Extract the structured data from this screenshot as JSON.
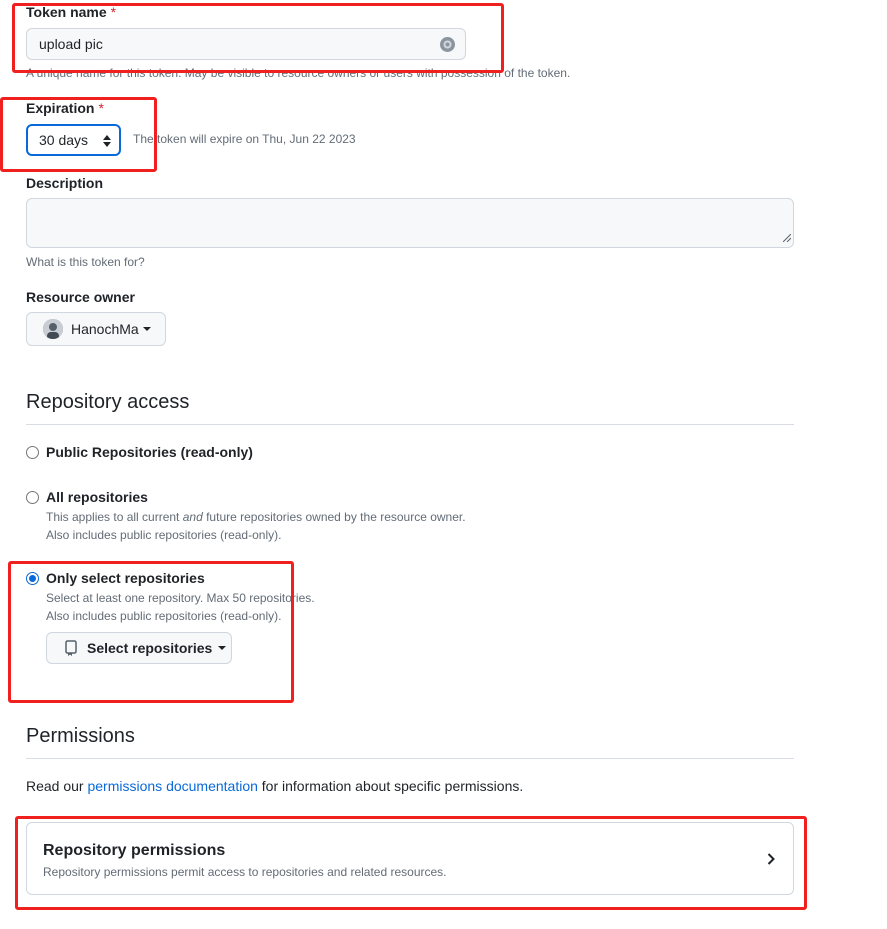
{
  "token_name": {
    "label": "Token name",
    "required_mark": "*",
    "value": "upload pic",
    "hint": "A unique name for this token. May be visible to resource owners or users with possession of the token."
  },
  "expiration": {
    "label": "Expiration",
    "required_mark": "*",
    "selected": "30 days",
    "note": "The token will expire on Thu, Jun 22 2023"
  },
  "description": {
    "label": "Description",
    "value": "",
    "hint": "What is this token for?"
  },
  "resource_owner": {
    "label": "Resource owner",
    "owner": "HanochMa"
  },
  "repository_access": {
    "heading": "Repository access",
    "options": [
      {
        "title": "Public Repositories (read-only)",
        "desc1": "",
        "desc2": "",
        "selected": false
      },
      {
        "title": "All repositories",
        "desc1_pre": "This applies to all current ",
        "desc1_em": "and",
        "desc1_post": " future repositories owned by the resource owner.",
        "desc2": "Also includes public repositories (read-only).",
        "selected": false
      },
      {
        "title": "Only select repositories",
        "desc1": "Select at least one repository. Max 50 repositories.",
        "desc2": "Also includes public repositories (read-only).",
        "selected": true
      }
    ],
    "select_button": "Select repositories"
  },
  "permissions": {
    "heading": "Permissions",
    "text_pre": "Read our ",
    "link": "permissions documentation",
    "text_post": " for information about specific permissions.",
    "repo_perm_title": "Repository permissions",
    "repo_perm_desc": "Repository permissions permit access to repositories and related resources."
  },
  "colors": {
    "accent": "#0969da",
    "annotation": "#f0201e",
    "required": "#d1242f"
  }
}
